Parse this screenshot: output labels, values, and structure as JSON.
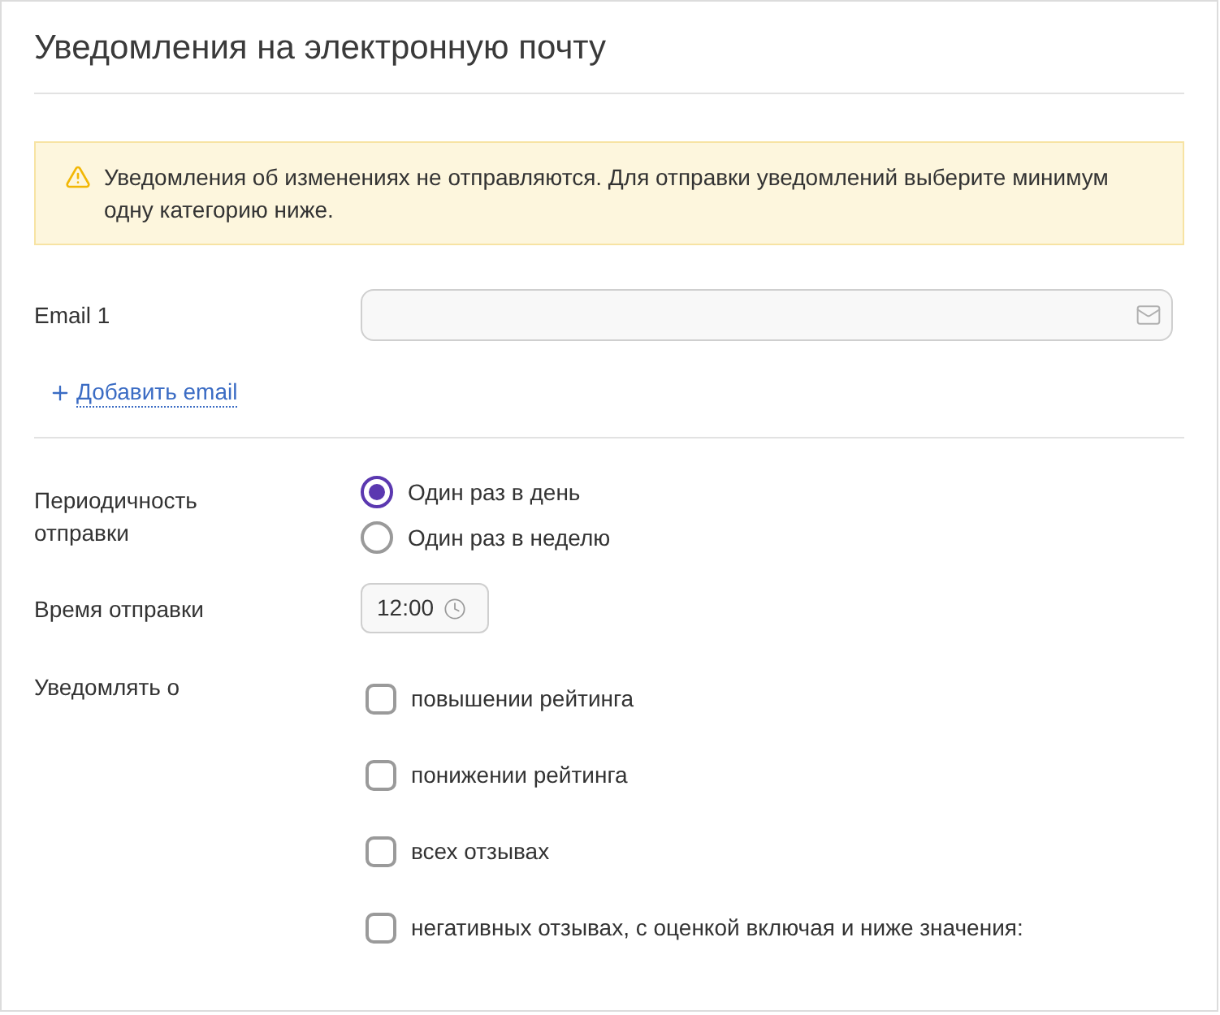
{
  "panel": {
    "title": "Уведомления на электронную почту"
  },
  "alert": {
    "text": "Уведомления об изменениях не отправляются. Для отправки уведомлений выберите минимум одну категорию ниже."
  },
  "email_fields": [
    {
      "label": "Email 1"
    }
  ],
  "add_email": {
    "label": "Добавить email"
  },
  "frequency": {
    "label": "Периодичность отправки",
    "options": [
      {
        "label": "Один раз в день",
        "selected": true
      },
      {
        "label": "Один раз в неделю",
        "selected": false
      }
    ]
  },
  "send_time": {
    "label": "Время отправки",
    "value": "12:00"
  },
  "notify": {
    "label": "Уведомлять о",
    "options": [
      {
        "label": "повышении рейтинга",
        "checked": false
      },
      {
        "label": "понижении рейтинга",
        "checked": false
      },
      {
        "label": "всех отзывах",
        "checked": false
      },
      {
        "label": "негативных отзывах, с оценкой включая и ниже значения:",
        "checked": false
      }
    ]
  }
}
